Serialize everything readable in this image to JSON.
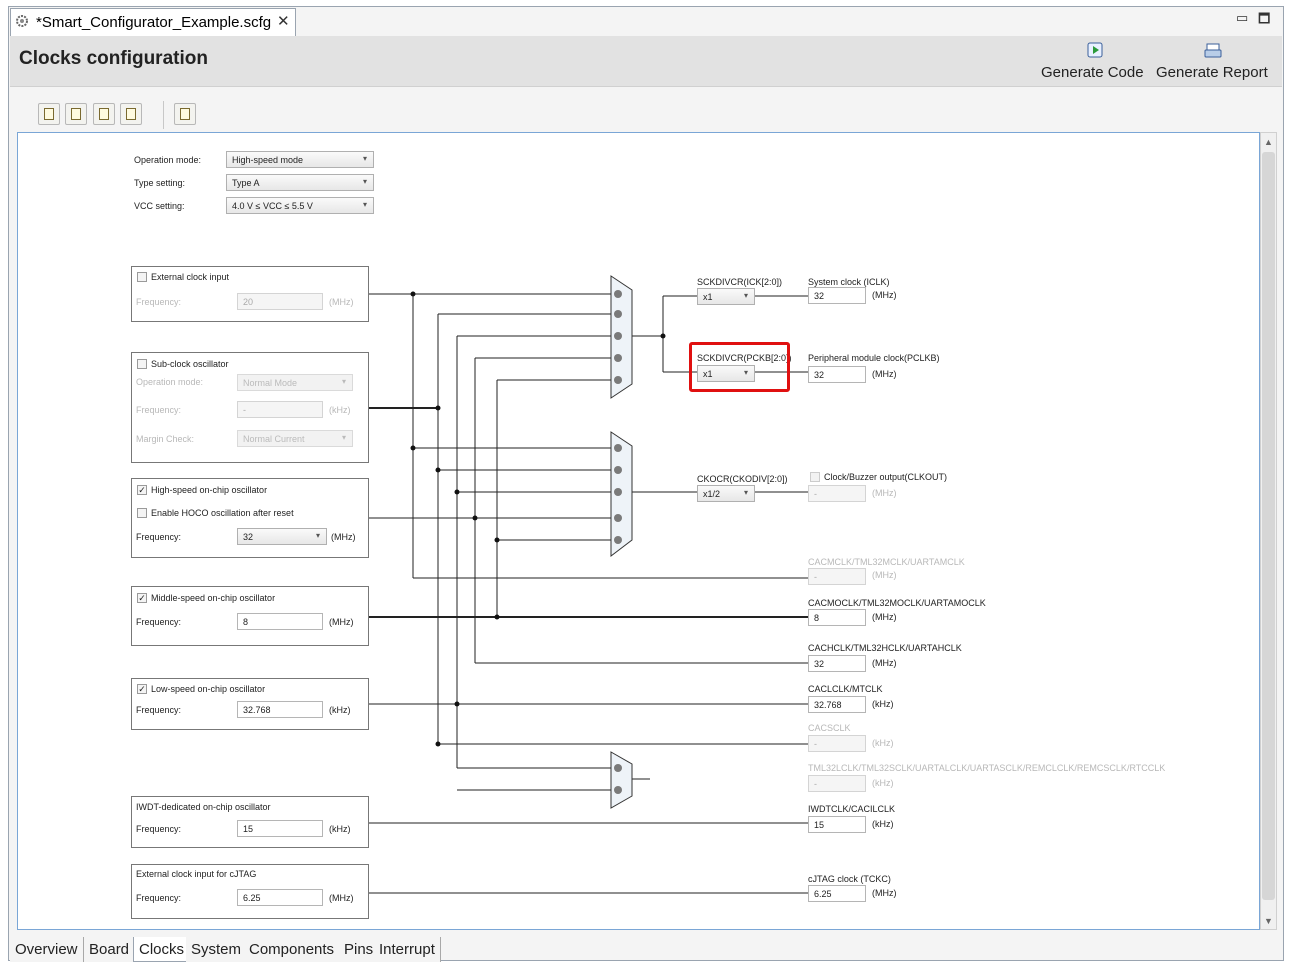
{
  "editor_tab": {
    "title": "*Smart_Configurator_Example.scfg",
    "close": "✕"
  },
  "window_controls": {
    "minimize": "▭",
    "maximize": "🗖"
  },
  "header": {
    "title": "Clocks configuration",
    "generate_code": "Generate Code",
    "generate_report": "Generate Report"
  },
  "settings": {
    "operation_mode_label": "Operation mode:",
    "operation_mode_value": "High-speed mode",
    "type_setting_label": "Type setting:",
    "type_setting_value": "Type A",
    "vcc_label": "VCC setting:",
    "vcc_value": "4.0 V ≤ VCC ≤ 5.5 V"
  },
  "ext_clock": {
    "label": "External clock input",
    "freq_label": "Frequency:",
    "freq_value": "20",
    "unit": "(MHz)"
  },
  "sub_clock": {
    "label": "Sub-clock oscillator",
    "mode_label": "Operation mode:",
    "mode_value": "Normal Mode",
    "freq_label": "Frequency:",
    "freq_value": "-",
    "unit": "(kHz)",
    "margin_label": "Margin Check:",
    "margin_value": "Normal Current"
  },
  "hoco": {
    "label": "High-speed on-chip oscillator",
    "after_reset_label": "Enable HOCO oscillation after reset",
    "freq_label": "Frequency:",
    "freq_value": "32",
    "unit": "(MHz)"
  },
  "moco": {
    "label": "Middle-speed on-chip oscillator",
    "freq_label": "Frequency:",
    "freq_value": "8",
    "unit": "(MHz)"
  },
  "loco": {
    "label": "Low-speed on-chip oscillator",
    "freq_label": "Frequency:",
    "freq_value": "32.768",
    "unit": "(kHz)"
  },
  "iwdt": {
    "label": "IWDT-dedicated on-chip oscillator",
    "freq_label": "Frequency:",
    "freq_value": "15",
    "unit": "(kHz)"
  },
  "cjtag_in": {
    "label": "External clock input for cJTAG",
    "freq_label": "Frequency:",
    "freq_value": "6.25",
    "unit": "(MHz)"
  },
  "dividers": {
    "ick_label": "SCKDIVCR(ICK[2:0])",
    "ick_value": "x1",
    "pckb_label": "SCKDIVCR(PCKB[2:0])",
    "pckb_value": "x1",
    "ckodiv_label": "CKOCR(CKODIV[2:0])",
    "ckodiv_value": "x1/2"
  },
  "outputs": {
    "iclk_label": "System clock (ICLK)",
    "iclk_value": "32",
    "iclk_unit": "(MHz)",
    "pclkb_label": "Peripheral module clock(PCLKB)",
    "pclkb_value": "32",
    "pclkb_unit": "(MHz)",
    "clkout_label": "Clock/Buzzer output(CLKOUT)",
    "clkout_value": "-",
    "clkout_unit": "(MHz)",
    "cacm_label": "CACMCLK/TML32MCLK/UARTAMCLK",
    "cacm_value": "-",
    "cacm_unit": "(MHz)",
    "cacmo_label": "CACMOCLK/TML32MOCLK/UARTAMOCLK",
    "cacmo_value": "8",
    "cacmo_unit": "(MHz)",
    "cach_label": "CACHCLK/TML32HCLK/UARTAHCLK",
    "cach_value": "32",
    "cach_unit": "(MHz)",
    "cacl_label": "CACLCLK/MTCLK",
    "cacl_value": "32.768",
    "cacl_unit": "(kHz)",
    "cacs_label": "CACSCLK",
    "cacs_value": "-",
    "cacs_unit": "(kHz)",
    "tml_label": "TML32LCLK/TML32SCLK/UARTALCLK/UARTASCLK/REMCLCLK/REMCSCLK/RTCCLK",
    "tml_value": "-",
    "tml_unit": "(kHz)",
    "iwdt_label": "IWDTCLK/CACILCLK",
    "iwdt_value": "15",
    "iwdt_unit": "(kHz)",
    "tckc_label": "cJTAG clock (TCKC)",
    "tckc_value": "6.25",
    "tckc_unit": "(MHz)"
  },
  "bottom_tabs": [
    "Overview",
    "Board",
    "Clocks",
    "System",
    "Components",
    "Pins",
    "Interrupt"
  ]
}
